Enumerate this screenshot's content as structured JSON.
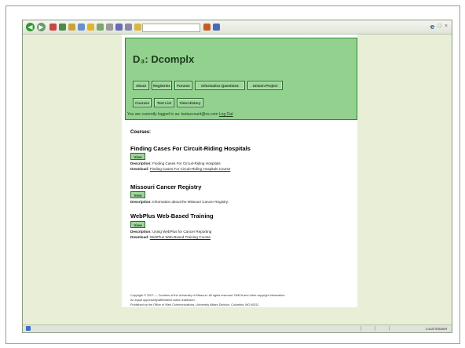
{
  "browser": {
    "status_zone": "Local intranet"
  },
  "site": {
    "logo": "D₃: Dcomplx",
    "nav_row1": [
      "About",
      "Registries",
      "Forums",
      "Informatics Questions",
      "Unison Project"
    ],
    "nav_row2": [
      "Courses",
      "Test List",
      "View History"
    ],
    "logged_in_prefix": "You are currently logged in as: testaccount@ns.com",
    "logout": "Log Out"
  },
  "content": {
    "heading": "Courses:",
    "view_label": "View",
    "description_label": "Description:",
    "download_label": "Download:",
    "courses": [
      {
        "title": "Finding Cases For Circuit-Riding Hospitals",
        "description": "Finding Cases For Circuit-Riding Hospitals",
        "download": "Finding Cases For Circuit-Riding Hospitals Course"
      },
      {
        "title": "Missouri Cancer Registry",
        "description": "Information about the Missouri Cancer Registry."
      },
      {
        "title": "WebPlus Web-Based Training",
        "description": "Using WebPlus for Cancer Reporting",
        "download": "WebPlus Web-Based Training Course"
      }
    ]
  },
  "footer": {
    "line1": "Copyright © 2007 — Curators of the University of Missouri. All rights reserved. DMCA and other copyright information.",
    "line2": "An equal opportunity/affirmative action institution.",
    "line3": "Published by the Office of Web Communications, University Affairs Division, Columbia, MO 65211"
  }
}
